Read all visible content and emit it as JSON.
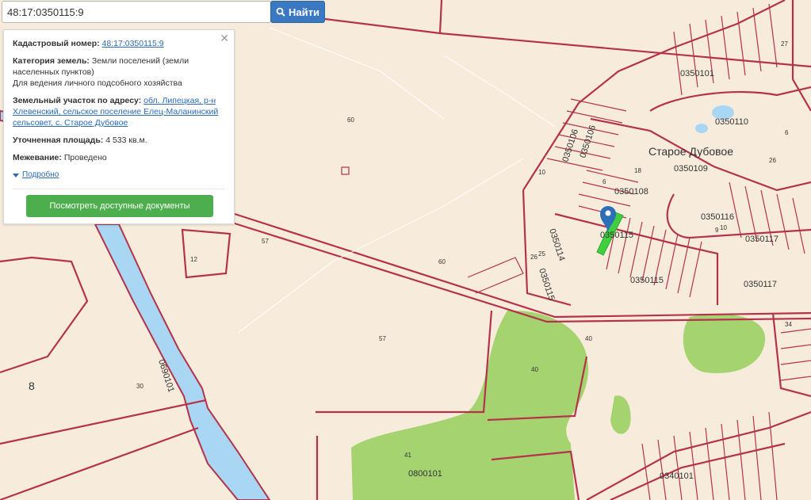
{
  "search": {
    "value": "48:17:0350115:9",
    "button_label": "Найти"
  },
  "info_panel": {
    "cadastral_label": "Кадастровый номер:",
    "cadastral_value": "48:17:0350115:9",
    "category_label": "Категория земель:",
    "category_value": "Земли поселений (земли населенных пунктов)",
    "category_use": "Для ведения личного подсобного хозяйства",
    "address_label": "Земельный участок по адресу:",
    "address_value": "обл. Липецкая, р-н Хлевенский, сельское поселение Елец-Маланинский сельсовет, с. Старое Дубовое",
    "area_label": "Уточненная площадь:",
    "area_value": "4 533 кв.м.",
    "survey_label": "Межевание:",
    "survey_value": "Проведено",
    "more_label": "Подробно",
    "docs_button": "Посмотреть доступные документы"
  },
  "map": {
    "village_name": "Старое Дубовое",
    "quarter_labels": [
      "0350101",
      "0350110",
      "0350109",
      "0350106",
      "0350106",
      "0350108",
      "0350116",
      "0350117",
      "0350117",
      "0350114",
      "0350115",
      "0350115",
      "0350115",
      "0350101",
      "0340101",
      "0690101",
      "0800101"
    ],
    "parcel_numbers": [
      "60",
      "57",
      "60",
      "57",
      "40",
      "40",
      "41",
      "30",
      "8",
      "12",
      "26",
      "25",
      "10",
      "18",
      "6",
      "9",
      "10",
      "34",
      "27",
      "26",
      "6"
    ],
    "colors": {
      "background": "#f7ecdc",
      "boundary": "#b5334a",
      "river": "#a9d6f2",
      "forest": "#9fd06a",
      "selected": "#3fcf3f",
      "marker": "#2d6fb6"
    }
  }
}
